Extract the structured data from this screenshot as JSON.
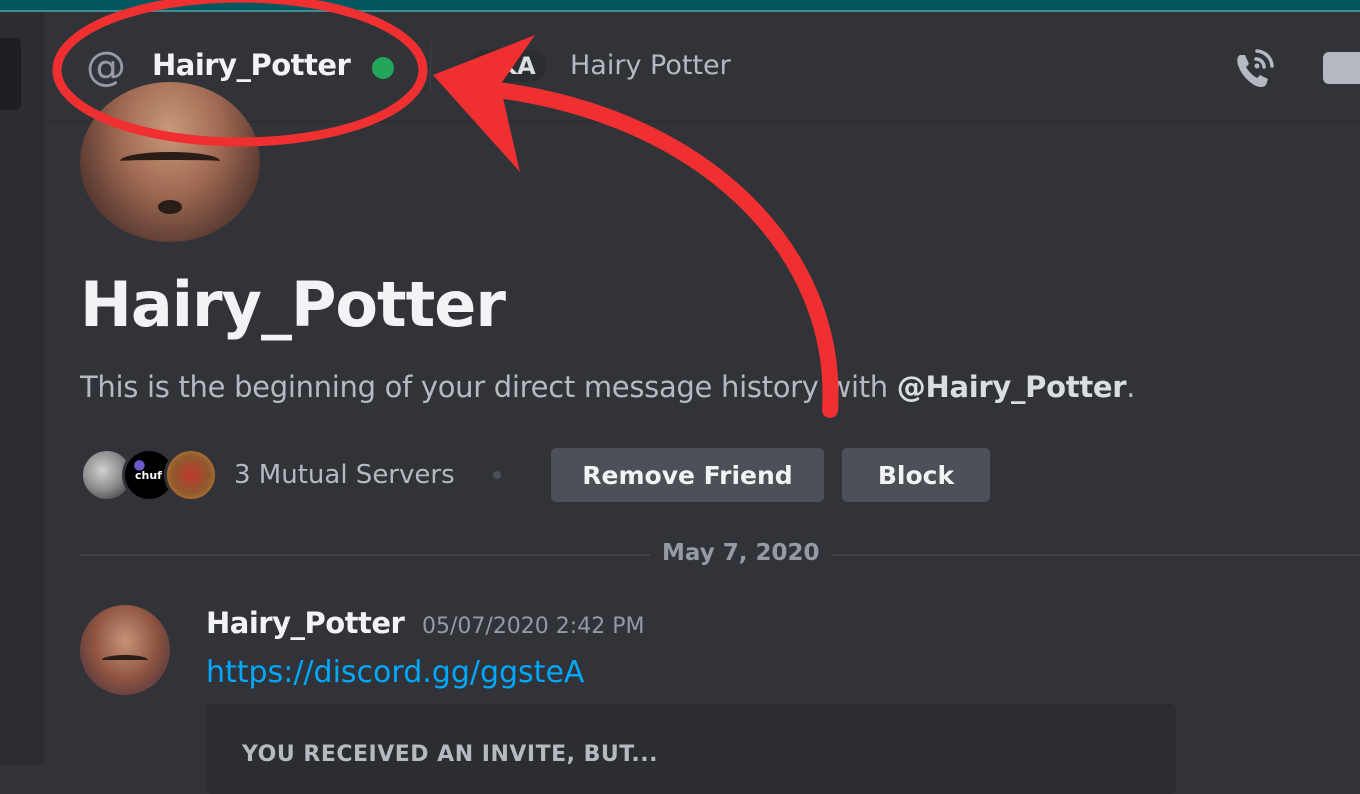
{
  "header": {
    "dm_name": "Hairy_Potter",
    "status": "online",
    "aka_label": "AKA",
    "aka_name": "Hairy Potter",
    "icons": [
      "at-icon",
      "voice-call-icon",
      "video-call-icon"
    ]
  },
  "profile": {
    "name": "Hairy_Potter",
    "intro_prefix": "This is the beginning of your direct message history with ",
    "intro_mention": "@Hairy_Potter",
    "intro_suffix": ".",
    "mutual_servers_label": "3 Mutual Servers",
    "mutual_servers": [
      {
        "label": ""
      },
      {
        "label": "chuf"
      },
      {
        "label": ""
      }
    ],
    "remove_friend_label": "Remove Friend",
    "block_label": "Block"
  },
  "divider": {
    "date": "May 7, 2020"
  },
  "message": {
    "author": "Hairy_Potter",
    "timestamp": "05/07/2020 2:42 PM",
    "link": "https://discord.gg/ggsteA",
    "invite_title": "YOU RECEIVED AN INVITE, BUT..."
  },
  "colors": {
    "background": "#313338",
    "online": "#23a55a",
    "link": "#00a8fc",
    "annotation": "#f03030",
    "titlebar": "#03575f"
  }
}
